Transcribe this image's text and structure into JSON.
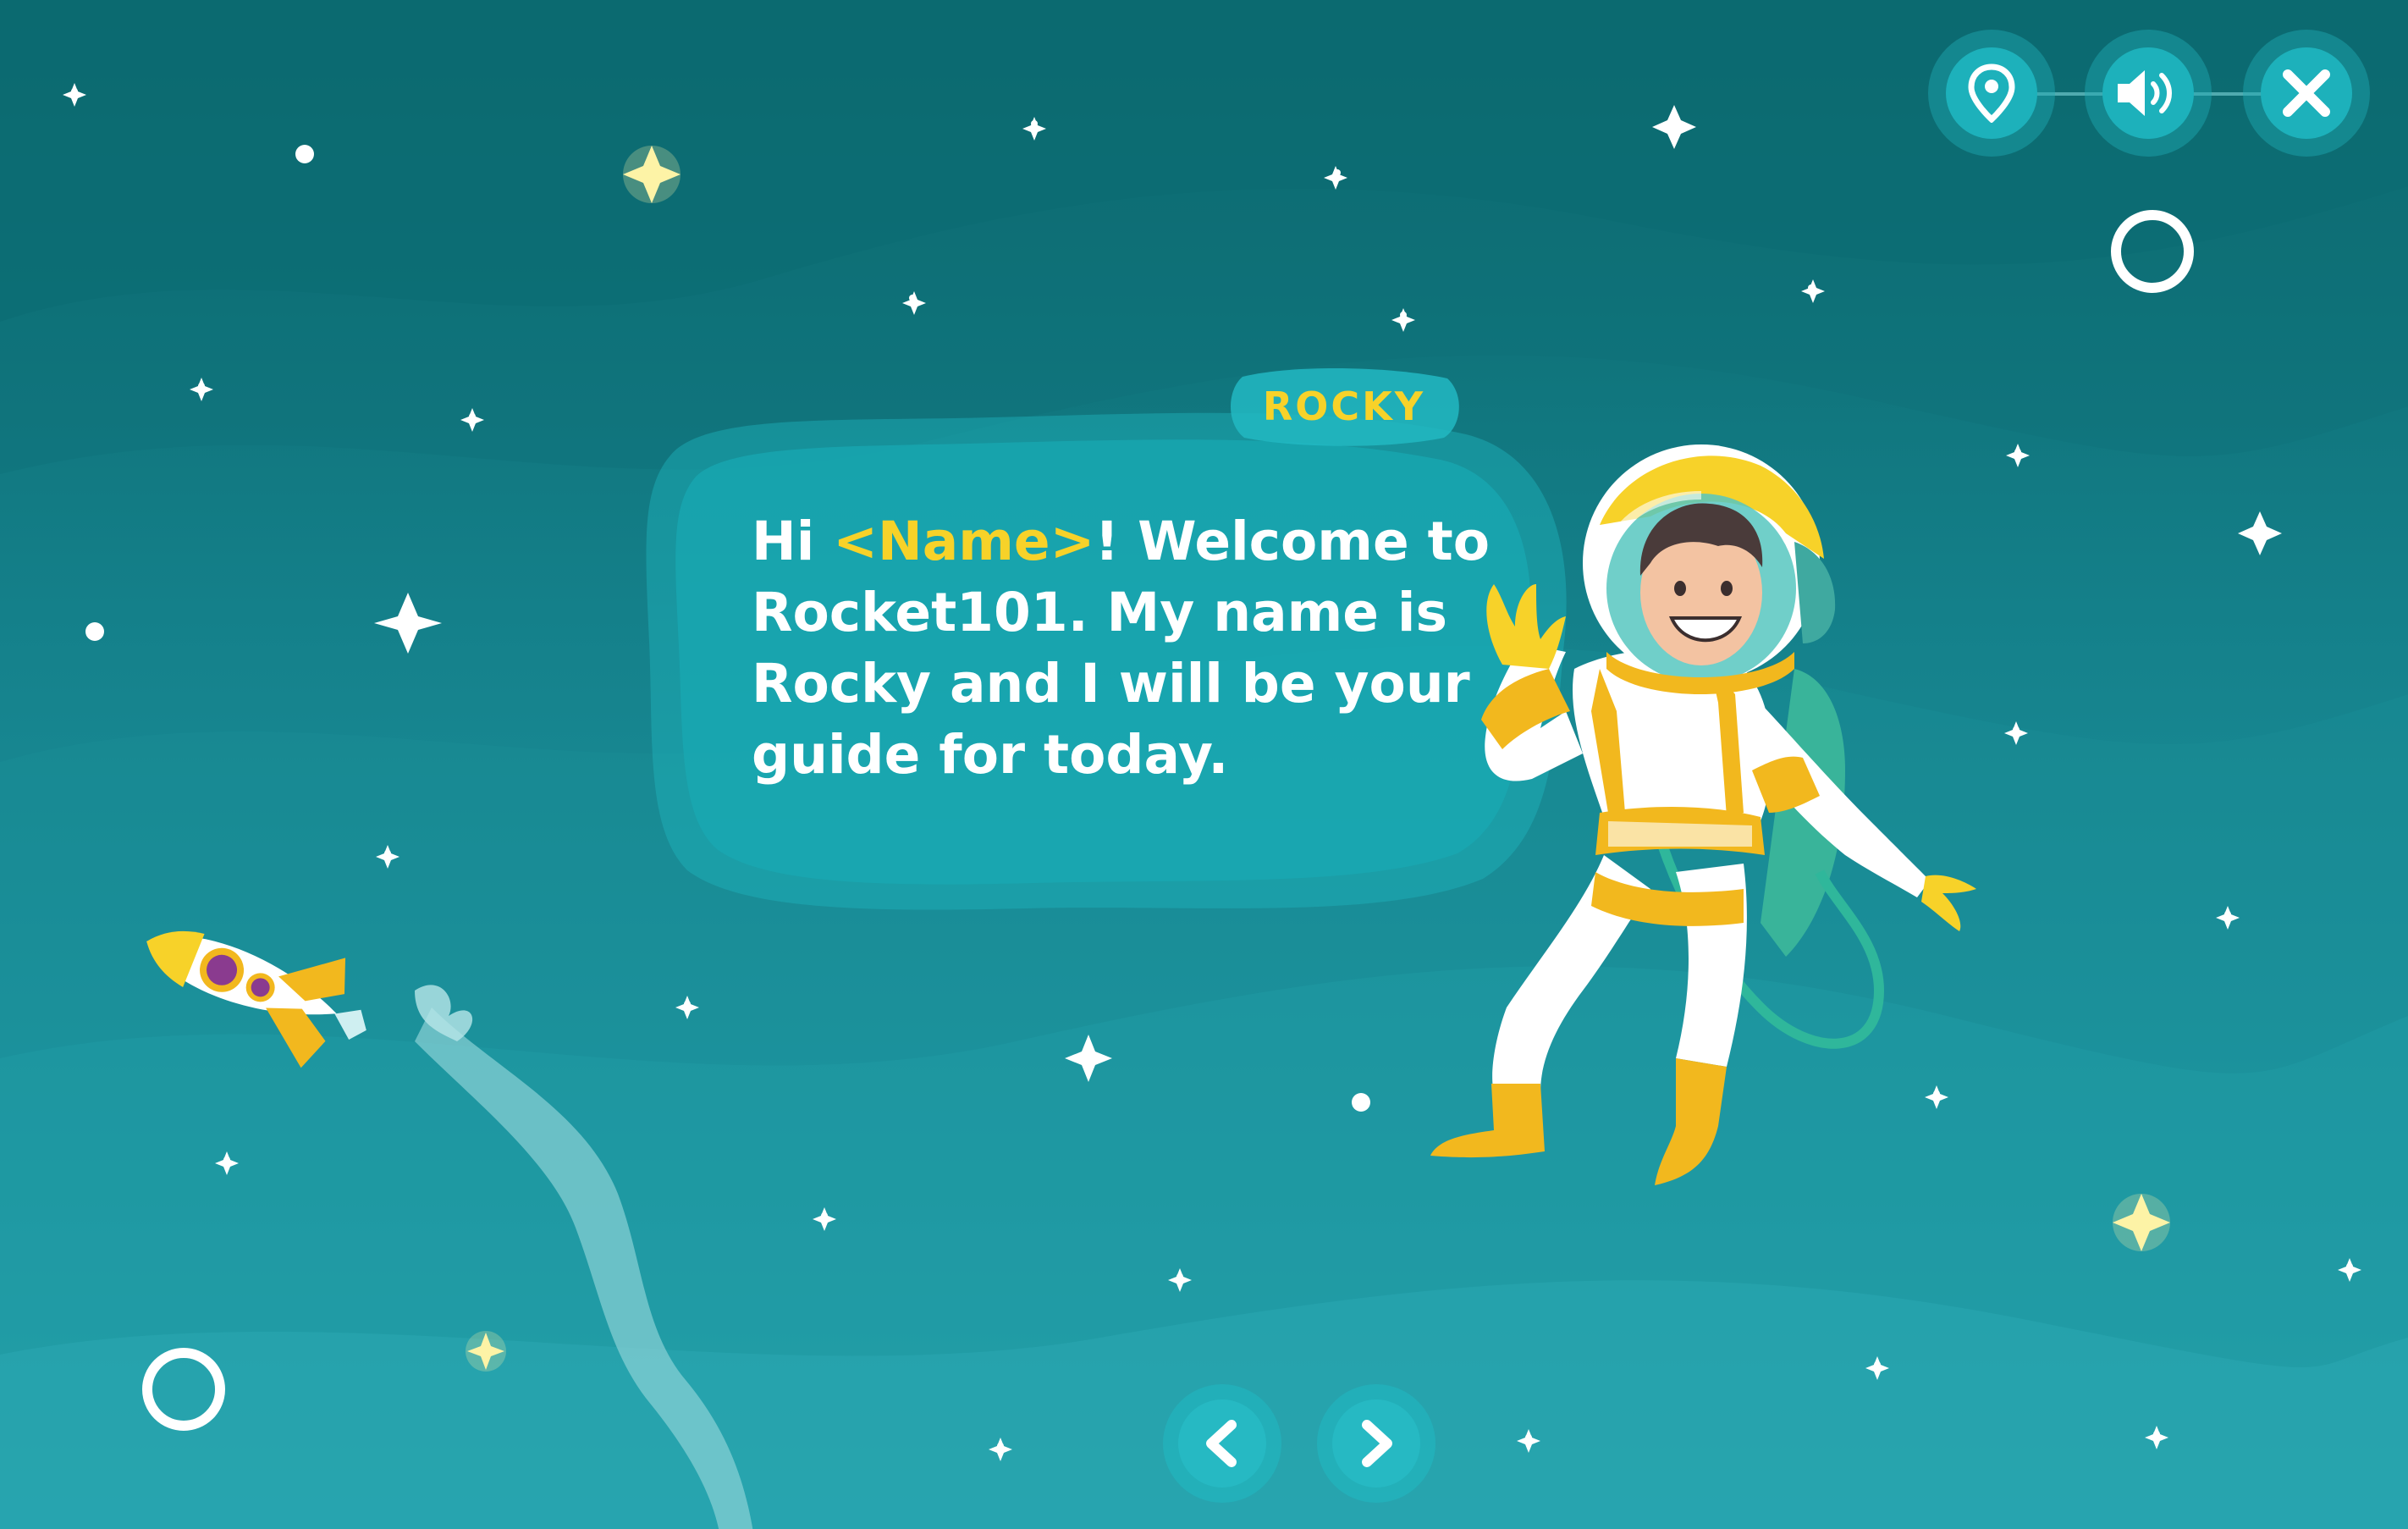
{
  "dialog": {
    "speaker": "ROCKY",
    "greeting_prefix": "Hi ",
    "name_placeholder": "<Name>",
    "line1_suffix": "! Welcome to",
    "line2": "Rocket101. My name is",
    "line3": "Rocky and I will be your",
    "line4": "guide for today."
  },
  "controls": {
    "location_icon": "map-pin-icon",
    "sound_icon": "speaker-volume-icon",
    "close_icon": "close-x-icon",
    "prev_icon": "chevron-left-icon",
    "next_icon": "chevron-right-icon"
  },
  "colors": {
    "bg_top": "#0a6468",
    "bg_bottom": "#2aa8b3",
    "accent_yellow": "#f7d229",
    "button_teal": "#1db1bb",
    "white": "#ffffff"
  }
}
